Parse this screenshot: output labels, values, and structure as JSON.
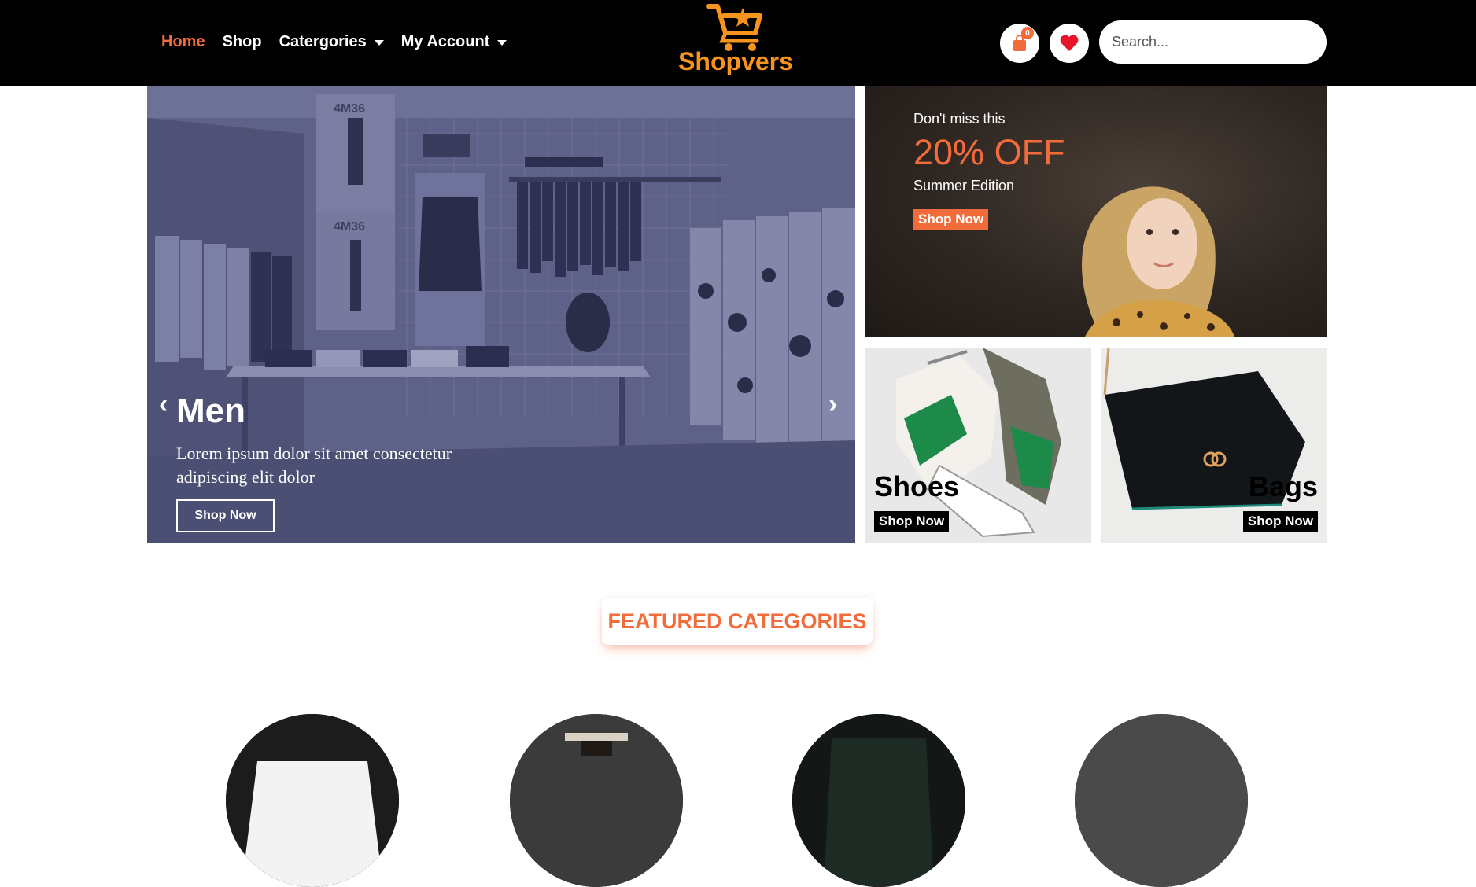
{
  "header": {
    "nav": [
      {
        "label": "Home",
        "active": true
      },
      {
        "label": "Shop"
      },
      {
        "label": "Catergories",
        "dropdown": true
      },
      {
        "label": "My Account",
        "dropdown": true
      }
    ],
    "logo_text": "Shopvers",
    "cart_count": "0",
    "search_placeholder": "Search..."
  },
  "hero": {
    "title": "Men",
    "description": "Lorem ipsum dolor sit amet consectetur adipiscing elit dolor",
    "button": "Shop Now",
    "poster_text": "4M36"
  },
  "promo": {
    "kicker": "Don't miss this",
    "headline": "20% OFF",
    "subtitle": "Summer Edition",
    "button": "Shop Now"
  },
  "tiles": [
    {
      "title": "Shoes",
      "button": "Shop Now"
    },
    {
      "title": "Bags",
      "button": "Shop Now"
    }
  ],
  "featured": {
    "title": "FEATURED CATEGORIES"
  },
  "colors": {
    "accent": "#f26b3a",
    "logo": "#f7941d",
    "header_bg": "#000000",
    "heart": "#e8142b"
  }
}
